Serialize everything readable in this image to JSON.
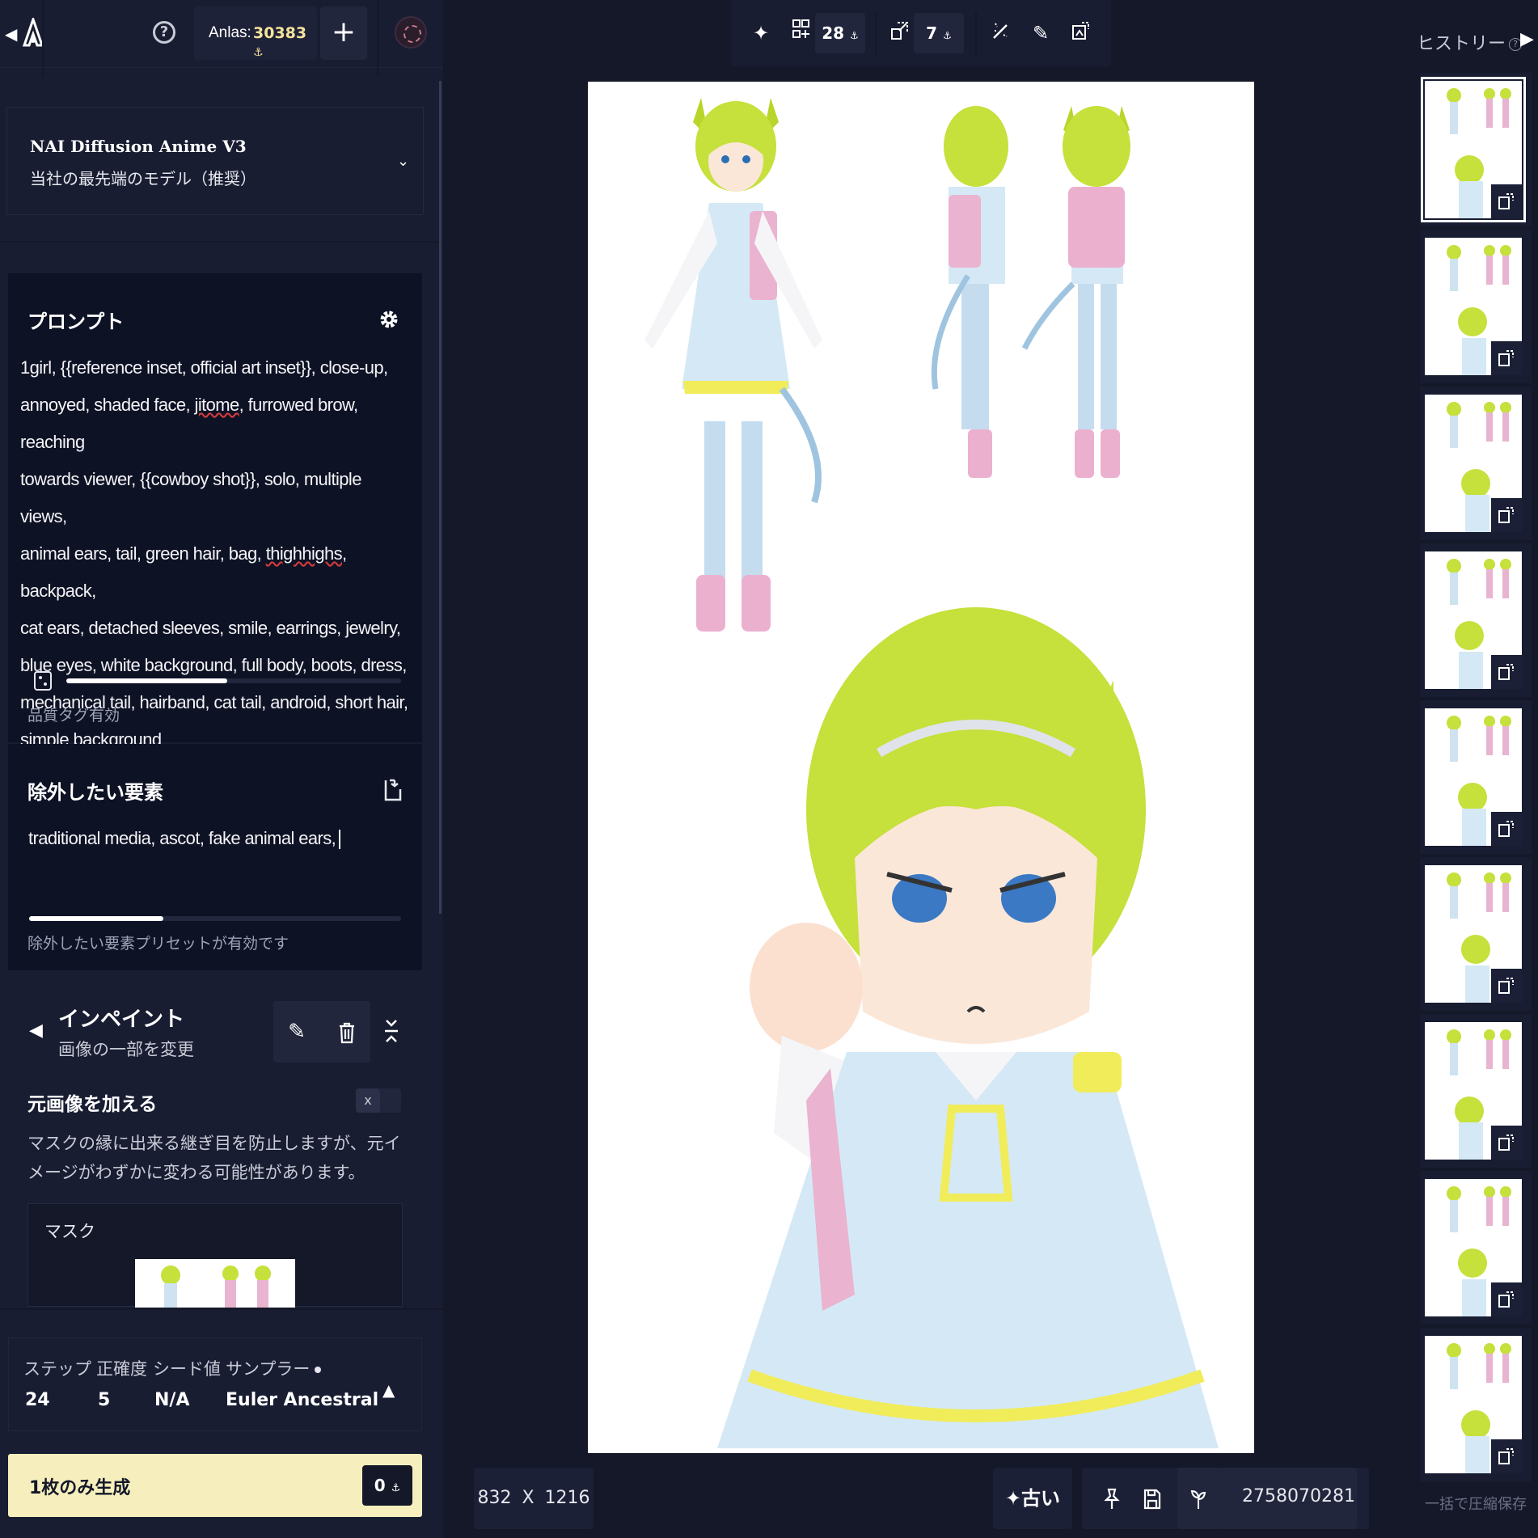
{
  "topbar": {
    "anlas_label": "Anlas:",
    "anlas_value": "30383",
    "plus_label": "+",
    "help_label": "?"
  },
  "model": {
    "name": "NAI Diffusion Anime V3",
    "subtitle": "当社の最先端のモデル（推奨）"
  },
  "prompt": {
    "title": "プロンプト",
    "lines": [
      "1girl, {{reference inset, official art inset}}, close-up,",
      "annoyed, shaded face, jitome, furrowed brow, reaching",
      "towards viewer, {{cowboy shot}}, solo, multiple views,",
      "animal ears, tail, green hair, bag, thighhighs, backpack,",
      "cat ears, detached sleeves, smile, earrings, jewelry,",
      "blue eyes, white background, full body, boots, dress,",
      "mechanical tail, hairband, cat tail, android, short hair,",
      "simple background"
    ],
    "quality_fill": 0.48,
    "quality_hint": "品質タグ有効"
  },
  "negative": {
    "title": "除外したい要素",
    "text": "traditional media, ascot, fake animal ears,",
    "preset_fill": 0.36,
    "preset_hint": "除外したい要素プリセットが有効です"
  },
  "inpaint": {
    "title": "インペイント",
    "subtitle": "画像の一部を変更",
    "add_source_title": "元画像を加える",
    "add_source_toggle": "x",
    "add_source_desc": "マスクの縁に出来る継ぎ目を防止しますが、元イメージがわずかに変わる可能性があります。",
    "mask_label": "マスク"
  },
  "settings": {
    "steps_label": "ステップ",
    "steps_value": "24",
    "guidance_label": "正確度",
    "guidance_value": "5",
    "seed_label": "シード値",
    "seed_value": "N/A",
    "sampler_label": "サンプラー",
    "sampler_value": "Euler Ancestral"
  },
  "generate": {
    "label": "1枚のみ生成",
    "cost": "0"
  },
  "toolbar": {
    "steps_count": "28",
    "upscale_count": "7"
  },
  "image_info": {
    "width": "832",
    "height": "1216",
    "times": "X",
    "old_label": "古い",
    "seed": "2758070281"
  },
  "history": {
    "title": "ヒストリー",
    "help": "?",
    "save_all": "一括で圧縮保存",
    "count": 9
  },
  "colors": {
    "bg": "#141829",
    "panel": "#191d32",
    "card": "#0e1225",
    "accent": "#f6efbd",
    "anlas": "#f6e49a"
  }
}
